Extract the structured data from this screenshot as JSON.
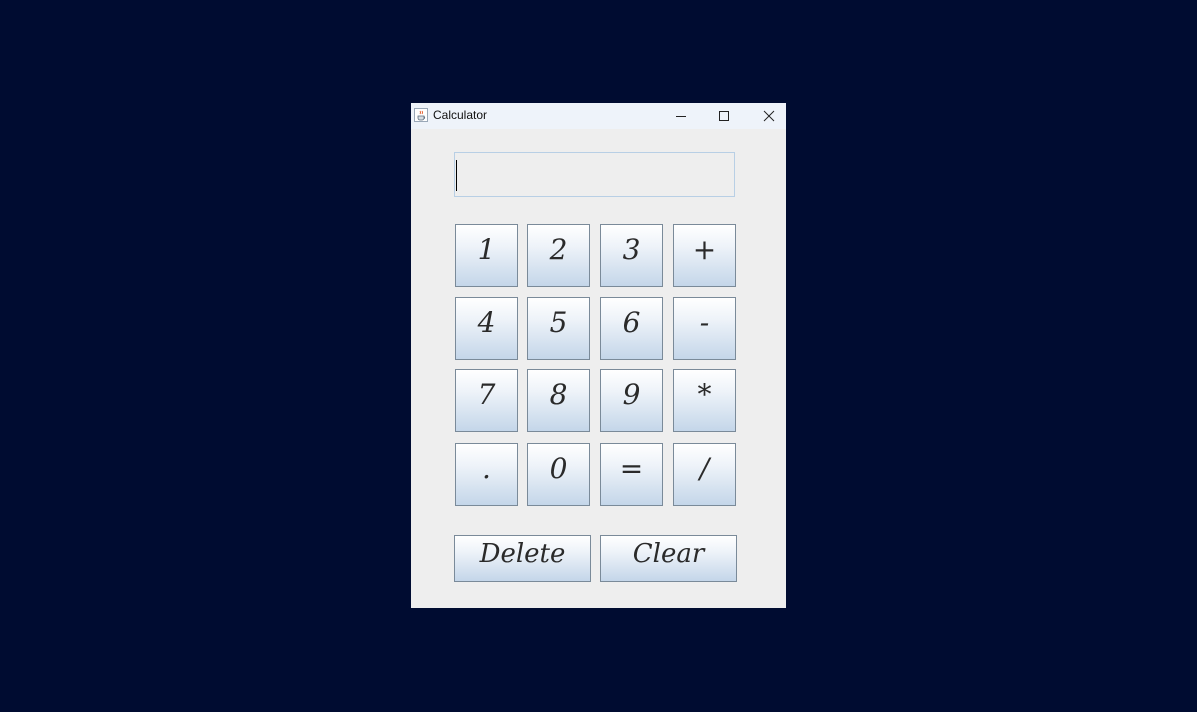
{
  "window": {
    "title": "Calculator",
    "icon": "java-cup-icon",
    "controls": [
      "minimize-icon",
      "maximize-icon",
      "close-icon"
    ]
  },
  "display": {
    "value": ""
  },
  "keypad": {
    "rows": [
      [
        "1",
        "2",
        "3",
        "+"
      ],
      [
        "4",
        "5",
        "6",
        "-"
      ],
      [
        "7",
        "8",
        "9",
        "*"
      ],
      [
        ".",
        "0",
        "=",
        "/"
      ]
    ]
  },
  "actions": {
    "delete_label": "Delete",
    "clear_label": "Clear"
  },
  "colors": {
    "desktop": "#000c31",
    "window_bg": "#eeeeee",
    "titlebar_bg": "#eef3fa"
  }
}
